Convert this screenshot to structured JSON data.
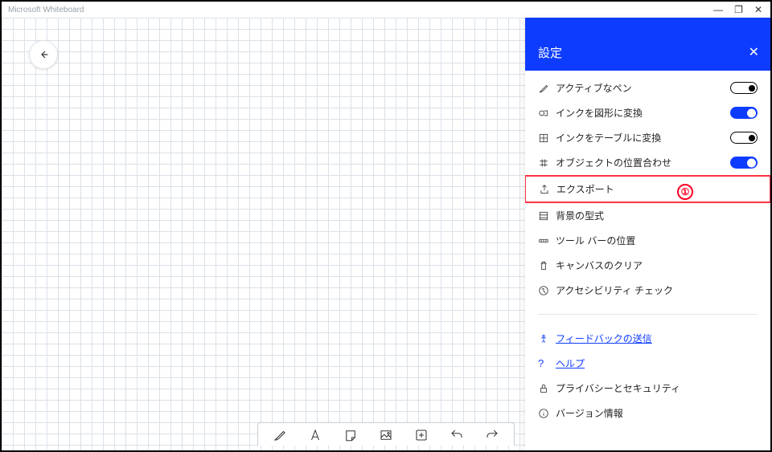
{
  "app": {
    "title": "Microsoft Whiteboard"
  },
  "panel": {
    "title": "設定",
    "items": [
      {
        "icon": "pen-icon",
        "label": "アクティブなペン",
        "toggle": "off"
      },
      {
        "icon": "shape-icon",
        "label": "インクを図形に変換",
        "toggle": "on"
      },
      {
        "icon": "grid-icon",
        "label": "インクをテーブルに変換",
        "toggle": "off"
      },
      {
        "icon": "snap-icon",
        "label": "オブジェクトの位置合わせ",
        "toggle": "on"
      },
      {
        "icon": "export-icon",
        "label": "エクスポート",
        "highlight": true
      },
      {
        "icon": "background-icon",
        "label": "背景の型式"
      },
      {
        "icon": "toolbar-pos-icon",
        "label": "ツール バーの位置"
      },
      {
        "icon": "clear-icon",
        "label": "キャンバスのクリア"
      },
      {
        "icon": "accessibility-icon",
        "label": "アクセシビリティ チェック"
      }
    ],
    "footer": [
      {
        "icon": "feedback-icon",
        "label": "フィードバックの送信",
        "link": true
      },
      {
        "icon": "help-icon",
        "label": "ヘルプ",
        "link": true
      },
      {
        "icon": "lock-icon",
        "label": "プライバシーとセキュリティ"
      },
      {
        "icon": "info-icon",
        "label": "バージョン情報"
      }
    ]
  },
  "annotation": {
    "number": "①"
  }
}
